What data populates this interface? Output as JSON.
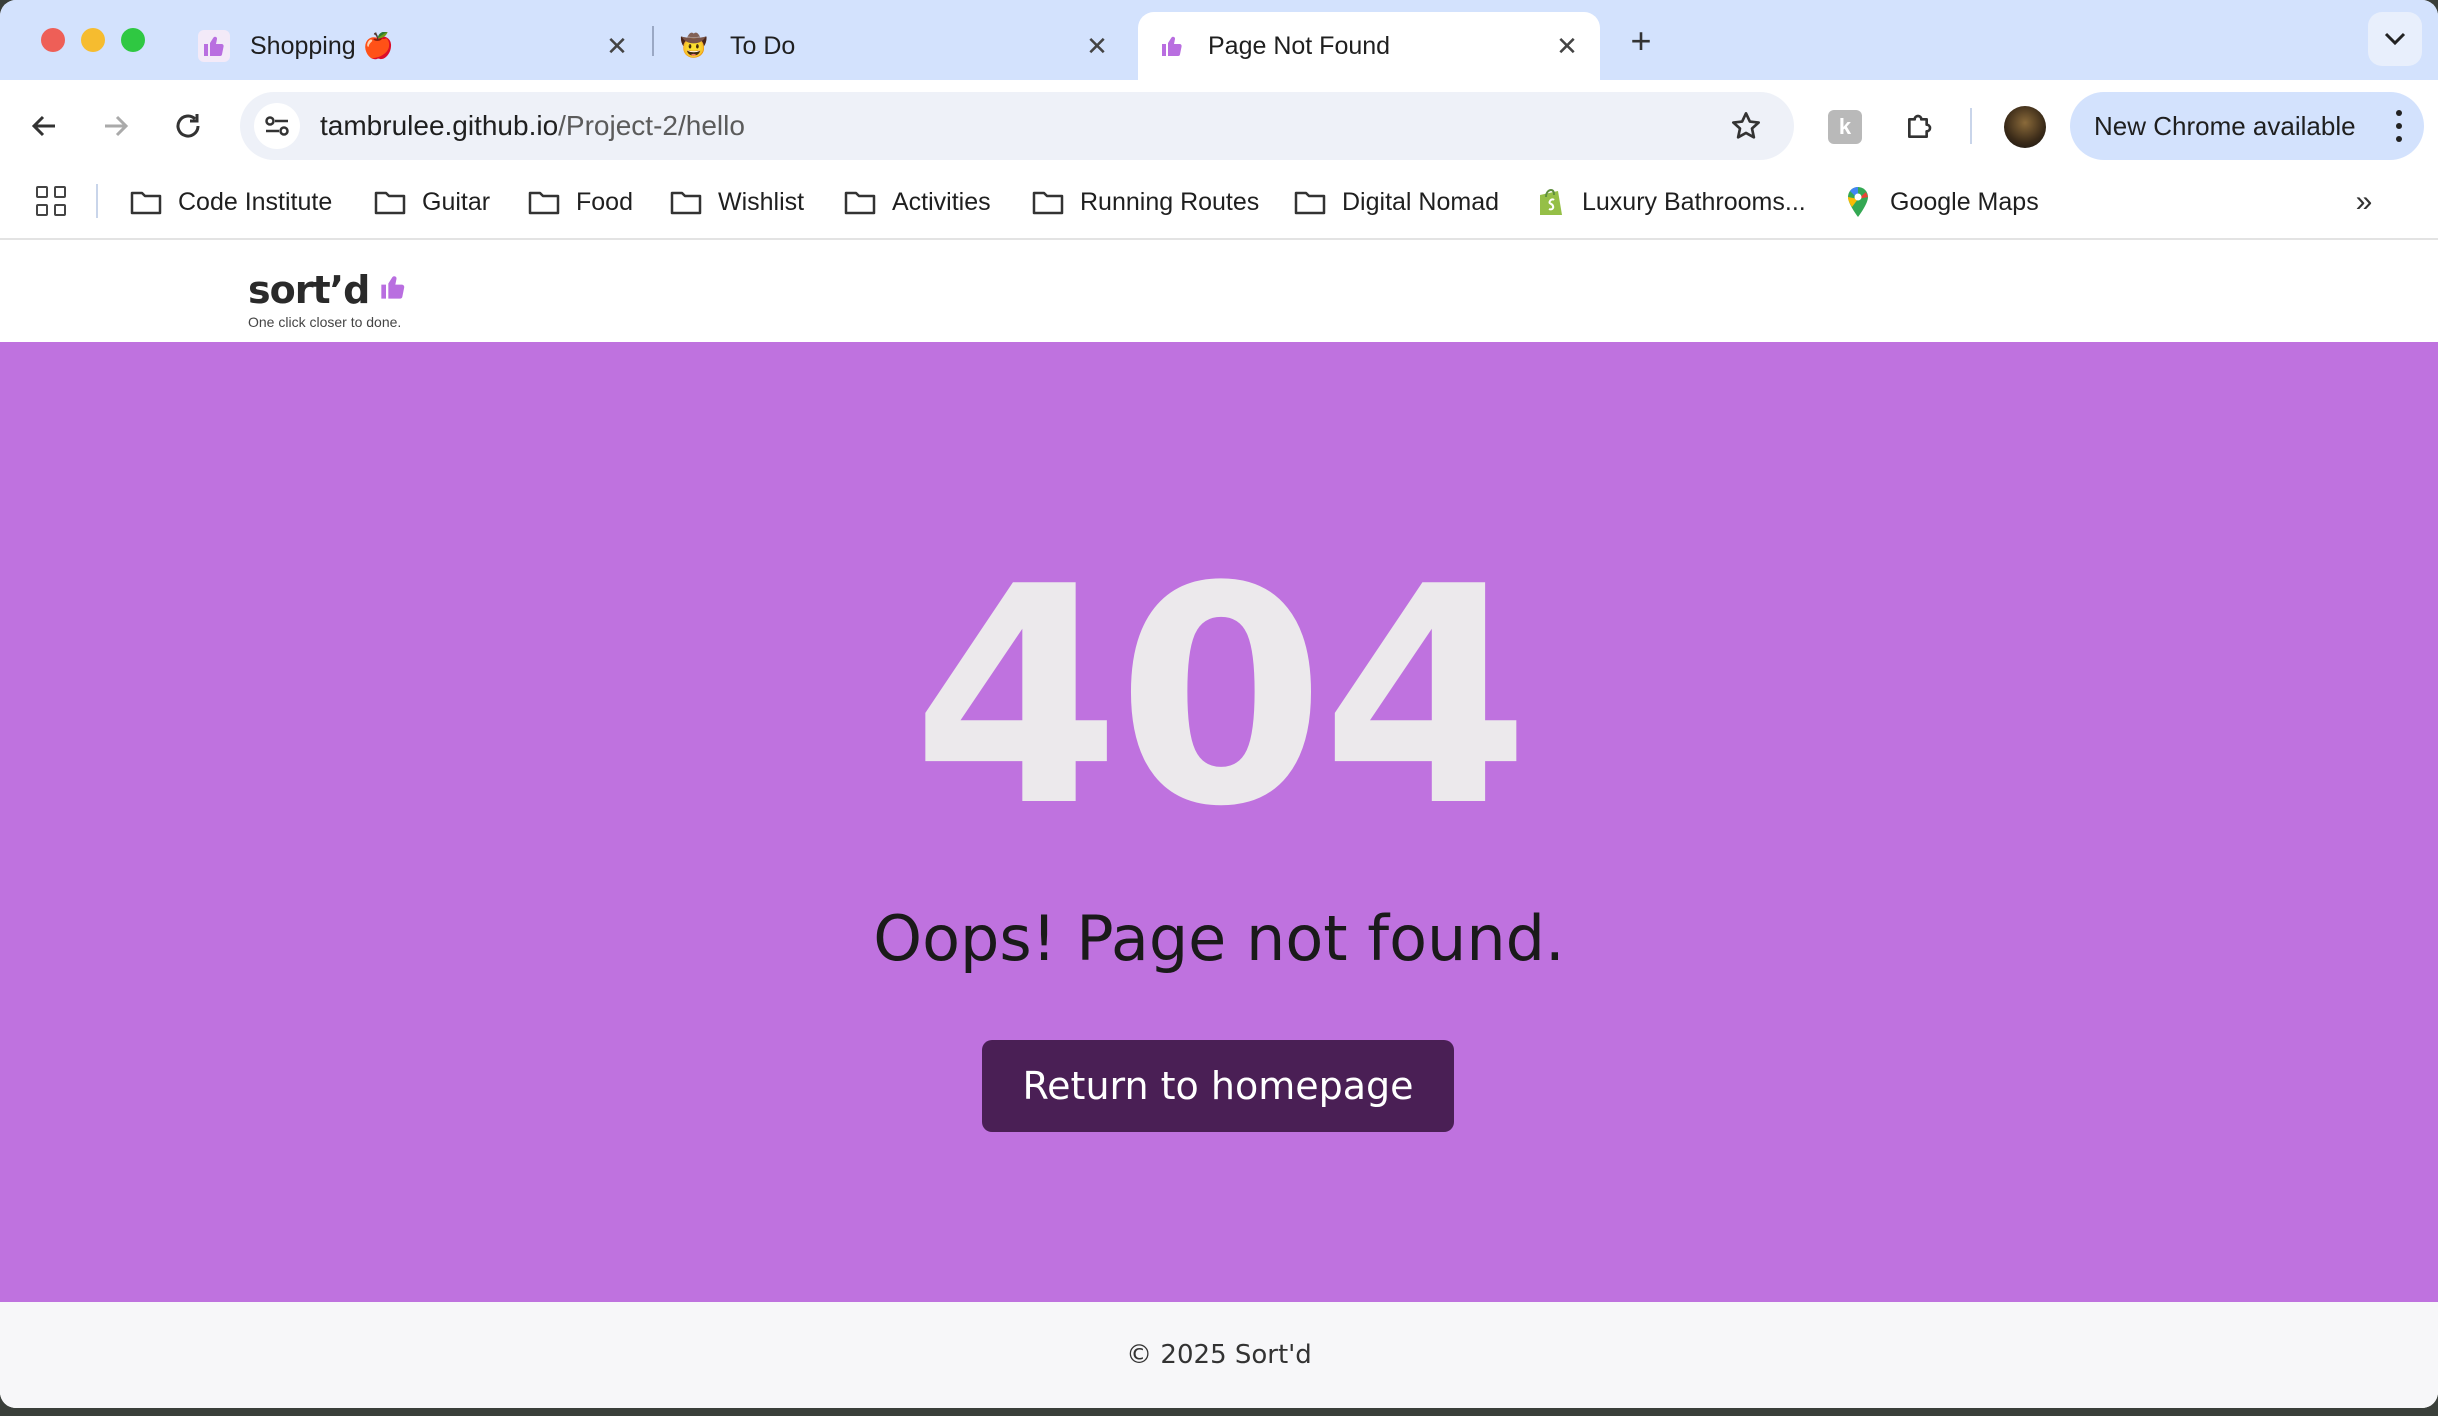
{
  "browser": {
    "tabs": [
      {
        "title": "Shopping 🍎",
        "icon": "thumbs-up-icon",
        "active": false
      },
      {
        "title": "To Do",
        "icon": "cowboy-emoji-icon",
        "active": false
      },
      {
        "title": "Page Not Found",
        "icon": "thumbs-up-icon",
        "active": true
      }
    ],
    "address": {
      "host": "tambrulee.github.io",
      "path": "/Project-2/hello"
    },
    "update_chip": "New Chrome available",
    "bookmarks": [
      {
        "label": "Code Institute",
        "icon": "folder-icon"
      },
      {
        "label": "Guitar",
        "icon": "folder-icon"
      },
      {
        "label": "Food",
        "icon": "folder-icon"
      },
      {
        "label": "Wishlist",
        "icon": "folder-icon"
      },
      {
        "label": "Activities",
        "icon": "folder-icon"
      },
      {
        "label": "Running Routes",
        "icon": "folder-icon"
      },
      {
        "label": "Digital Nomad",
        "icon": "folder-icon"
      },
      {
        "label": "Luxury Bathrooms...",
        "icon": "shopify-bag-icon"
      },
      {
        "label": "Google Maps",
        "icon": "map-pin-icon"
      }
    ]
  },
  "site": {
    "logo_text": "sort’d",
    "tagline": "One click closer to done.",
    "error_code": "404",
    "message": "Oops! Page not found.",
    "button_label": "Return to homepage",
    "footer": "© 2025 Sort'd"
  },
  "colors": {
    "hero_bg": "#bf72df",
    "button_bg": "#4a1f55",
    "tabstrip_bg": "#d3e2fd"
  }
}
